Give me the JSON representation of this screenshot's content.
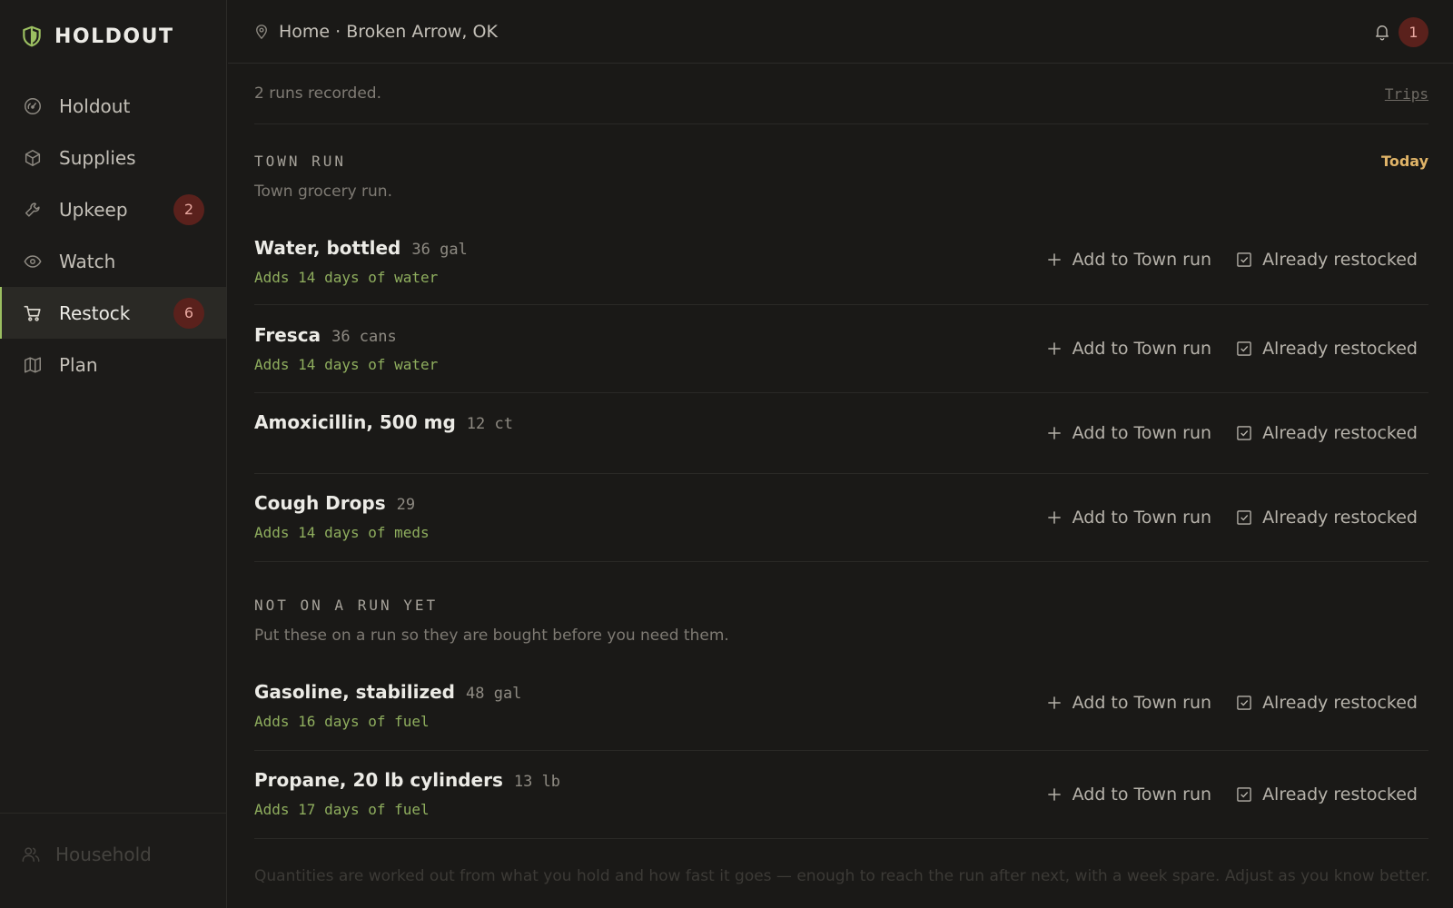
{
  "app": {
    "name": "HOLDOUT"
  },
  "sidebar": {
    "items": [
      {
        "label": "Holdout",
        "icon": "gauge-icon",
        "badge": ""
      },
      {
        "label": "Supplies",
        "icon": "box-icon",
        "badge": ""
      },
      {
        "label": "Upkeep",
        "icon": "wrench-icon",
        "badge": "2"
      },
      {
        "label": "Watch",
        "icon": "eye-icon",
        "badge": ""
      },
      {
        "label": "Restock",
        "icon": "cart-icon",
        "badge": "6",
        "active": true
      },
      {
        "label": "Plan",
        "icon": "map-icon",
        "badge": ""
      }
    ],
    "footer": {
      "label": "Household",
      "icon": "users-icon"
    }
  },
  "topbar": {
    "location": "Home · Broken Arrow, OK",
    "notifications": "1"
  },
  "main": {
    "summary": "2 runs recorded.",
    "trips_link": "Trips",
    "sections": [
      {
        "title": "TOWN RUN",
        "when": "Today",
        "description": "Town grocery run.",
        "items": [
          {
            "name": "Water, bottled",
            "qty": "36 gal",
            "note": "Adds 14 days of water"
          },
          {
            "name": "Fresca",
            "qty": "36 cans",
            "note": "Adds 14 days of water"
          },
          {
            "name": "Amoxicillin, 500 mg",
            "qty": "12 ct",
            "note": ""
          },
          {
            "name": "Cough Drops",
            "qty": "29",
            "note": "Adds 14 days of meds"
          }
        ]
      },
      {
        "title": "NOT ON A RUN YET",
        "when": "",
        "description": "Put these on a run so they are bought before you need them.",
        "items": [
          {
            "name": "Gasoline, stabilized",
            "qty": "48 gal",
            "note": "Adds 16 days of fuel"
          },
          {
            "name": "Propane, 20 lb cylinders",
            "qty": "13 lb",
            "note": "Adds 17 days of fuel"
          }
        ]
      }
    ],
    "actions": {
      "add_label": "Add to Town run",
      "restocked_label": "Already restocked"
    },
    "footnote": "Quantities are worked out from what you hold and how fast it goes — enough to reach the run after next, with a week spare. Adjust as you know better."
  },
  "colors": {
    "accent": "#9bbf61",
    "badge": "#5a211c",
    "today": "#e0b468",
    "note": "#8fae5e"
  }
}
